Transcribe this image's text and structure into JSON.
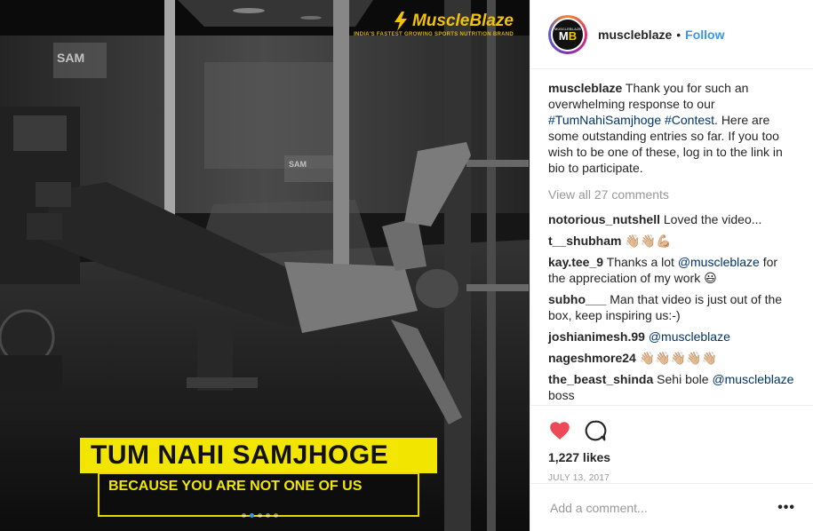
{
  "media": {
    "brand_logo": "MuscleBlaze",
    "brand_tagline": "INDIA'S FASTEST GROWING SPORTS NUTRITION BRAND",
    "gym_sign_1": "SAM",
    "gym_sign_2": "SAM",
    "banner_title": "TUM NAHI SAMJHOGE",
    "banner_subtitle": "BECAUSE YOU ARE NOT ONE OF US",
    "carousel": {
      "count": 5,
      "active_index": 1
    }
  },
  "header": {
    "username": "muscleblaze",
    "separator": "•",
    "follow_label": "Follow",
    "avatar_text_top": "MUSCLEBLAZE",
    "avatar_text_m": "M",
    "avatar_text_b": "B"
  },
  "caption": {
    "username": "muscleblaze",
    "text_1": "Thank you for such an overwhelming response to our",
    "hashtag_1": "#TumNahiSamjhoge",
    "hashtag_2": "#Contest",
    "text_2": ". Here are some outstanding entries so far. If you too wish to be one of these, log in to the link in bio to participate."
  },
  "view_all_label": "View all 27 comments",
  "comments": [
    {
      "user": "notorious_nutshell",
      "text": "Loved the video..."
    },
    {
      "user": "t__shubham",
      "text": "👋🏼👋🏼💪🏼"
    },
    {
      "user": "kay.tee_9",
      "text_pre": "Thanks a lot",
      "mention": "@muscleblaze",
      "text_post": "for the appreciation of my work 😃"
    },
    {
      "user": "subho___",
      "text": "Man that video is just out of the box, keep inspiring us:-)"
    },
    {
      "user": "joshianimesh.99",
      "mention": "@muscleblaze"
    },
    {
      "user": "nageshmore24",
      "text": "👋🏼👋🏼👋🏼👋🏼👋🏼"
    },
    {
      "user": "the_beast_shinda",
      "text_pre": "Sehi bole",
      "mention": "@muscleblaze",
      "text_post": "boss"
    }
  ],
  "likes": "1,227 likes",
  "date": "JULY 13, 2017",
  "add_comment": {
    "placeholder": "Add a comment...",
    "more_label": "•••"
  },
  "colors": {
    "like_red": "#ed4956",
    "link_blue": "#3897f0",
    "hashtag": "#003569",
    "banner_yellow": "#f2e600"
  },
  "icons": [
    "heart-icon",
    "comment-icon",
    "more-options-icon"
  ]
}
